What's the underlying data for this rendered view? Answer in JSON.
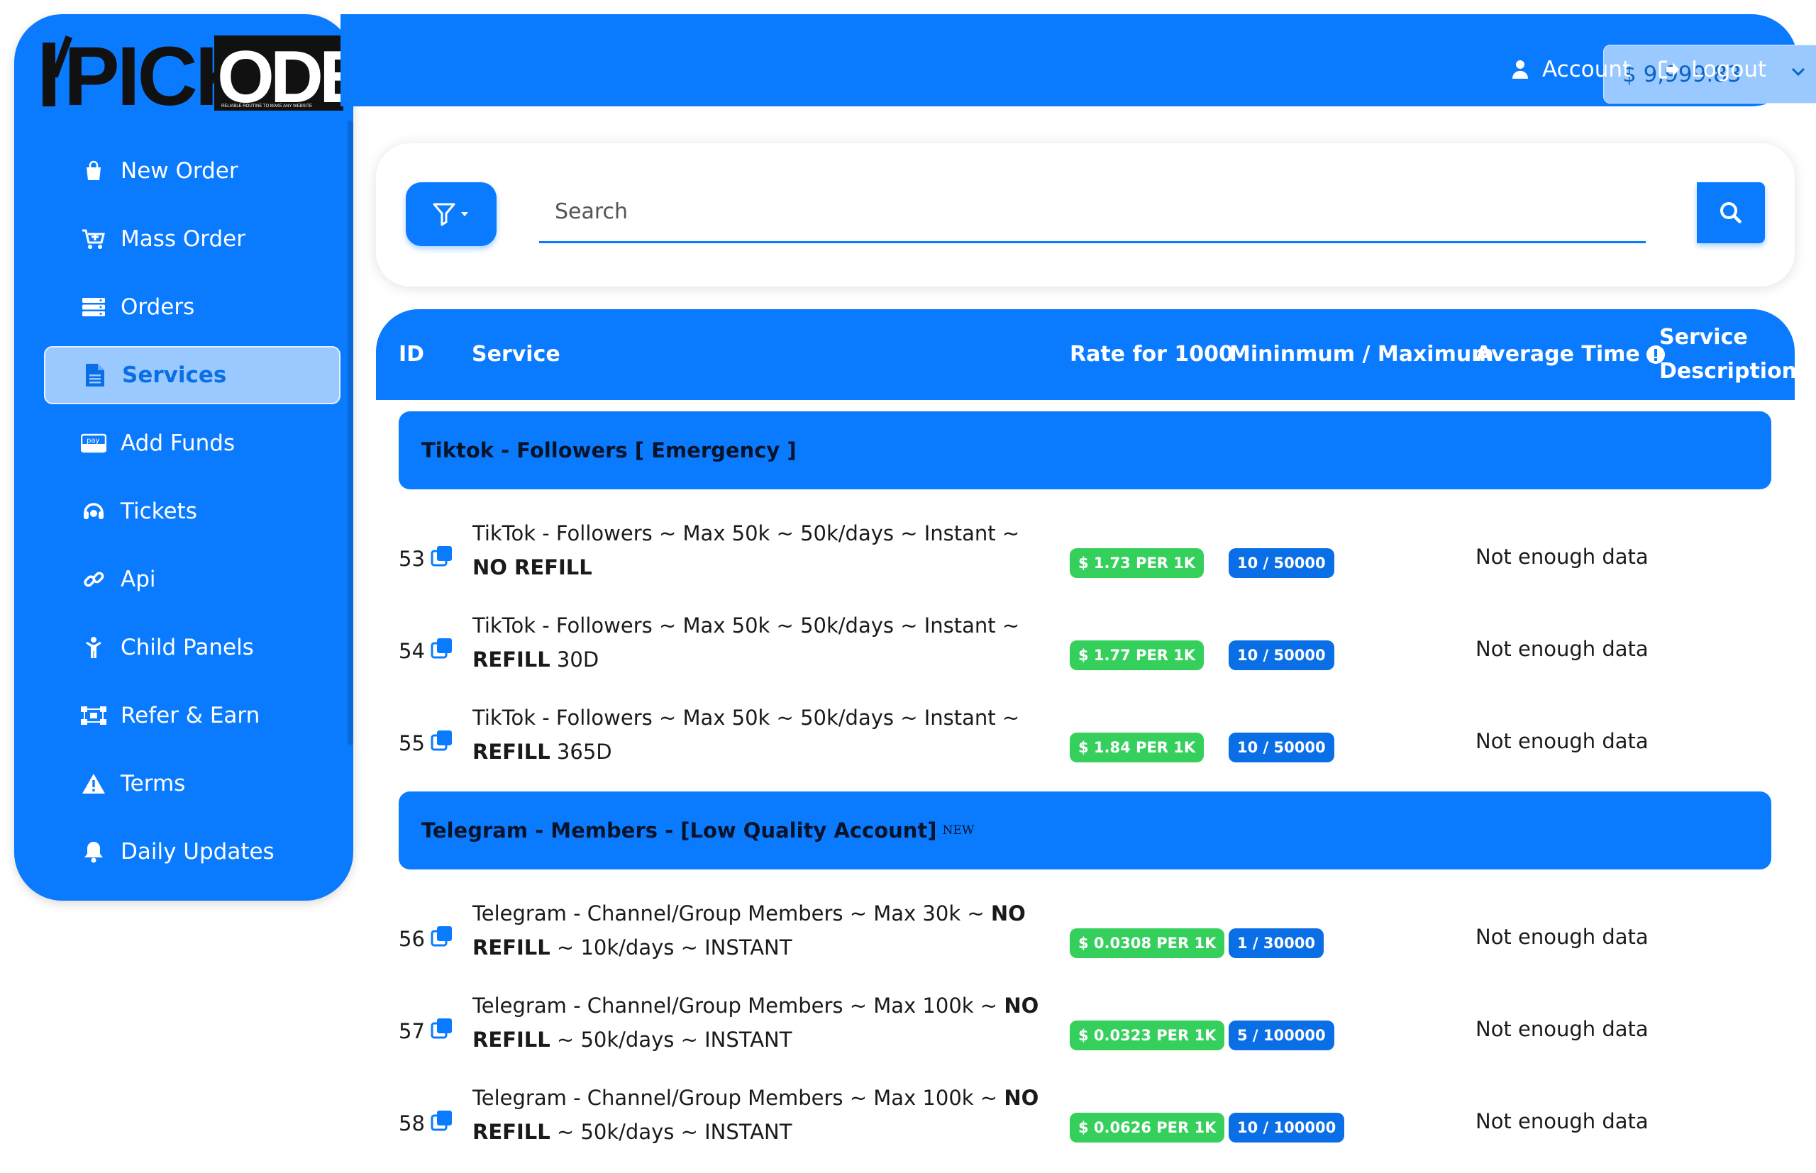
{
  "brand": {
    "logo_text": "PICKODER",
    "tagline": "RELIABLE ROUTINE TO MAKE ANY WEBSITE"
  },
  "header": {
    "balance": "$ 9,999.83",
    "account_label": "Account",
    "logout_label": "Logout"
  },
  "sidebar": {
    "items": [
      {
        "label": "New Order",
        "icon": "shopping-bag-icon"
      },
      {
        "label": "Mass Order",
        "icon": "cart-plus-icon"
      },
      {
        "label": "Orders",
        "icon": "list-icon"
      },
      {
        "label": "Services",
        "icon": "document-icon",
        "active": true
      },
      {
        "label": "Add Funds",
        "icon": "pay-icon"
      },
      {
        "label": "Tickets",
        "icon": "headset-icon"
      },
      {
        "label": "Api",
        "icon": "link-icon"
      },
      {
        "label": "Child Panels",
        "icon": "child-icon"
      },
      {
        "label": "Refer & Earn",
        "icon": "network-icon"
      },
      {
        "label": "Terms",
        "icon": "warning-icon"
      },
      {
        "label": "Daily Updates",
        "icon": "bell-icon"
      }
    ]
  },
  "search": {
    "placeholder": "Search"
  },
  "table": {
    "headers": {
      "id": "ID",
      "service": "Service",
      "rate": "Rate for 1000",
      "minmax": "Mininmum / Maximum",
      "avg": "Average Time",
      "desc_line1": "Service",
      "desc_line2": "Description"
    }
  },
  "categories": [
    {
      "title": "Tiktok - Followers [ Emergency ]",
      "badge": "",
      "services": [
        {
          "id": "53",
          "name": "TikTok - Followers ~ Max 50k ~ 50k/days ~ Instant ~ ",
          "name_bold": "NO REFILL",
          "name_rest": "",
          "rate": "$ 1.73 PER 1K",
          "minmax": "10 / 50000",
          "avg": "Not enough data"
        },
        {
          "id": "54",
          "name": "TikTok - Followers ~ Max 50k ~ 50k/days ~ Instant ~ ",
          "name_bold": "REFILL",
          "name_rest": " 30D",
          "rate": "$ 1.77 PER 1K",
          "minmax": "10 / 50000",
          "avg": "Not enough data"
        },
        {
          "id": "55",
          "name": "TikTok - Followers ~ Max 50k ~ 50k/days ~ Instant ~ ",
          "name_bold": "REFILL",
          "name_rest": " 365D",
          "rate": "$ 1.84 PER 1K",
          "minmax": "10 / 50000",
          "avg": "Not enough data"
        }
      ]
    },
    {
      "title": "Telegram - Members - [Low Quality Account]",
      "badge": "NEW",
      "services": [
        {
          "id": "56",
          "name": "Telegram - Channel/Group Members ~ Max 30k ~ ",
          "name_bold": "NO REFILL",
          "name_rest": " ~ 10k/days ~ INSTANT",
          "rate": "$ 0.0308 PER 1K",
          "minmax": "1 / 30000",
          "avg": "Not enough data"
        },
        {
          "id": "57",
          "name": "Telegram - Channel/Group Members ~ Max 100k ~ ",
          "name_bold": "NO REFILL",
          "name_rest": " ~ 50k/days ~ INSTANT",
          "rate": "$ 0.0323 PER 1K",
          "minmax": "5 / 100000",
          "avg": "Not enough data"
        },
        {
          "id": "58",
          "name": "Telegram - Channel/Group Members ~ Max 100k ~ ",
          "name_bold": "NO REFILL",
          "name_rest": " ~ 50k/days ~ INSTANT",
          "rate": "$ 0.0626 PER 1K",
          "minmax": "10 / 100000",
          "avg": "Not enough data"
        }
      ]
    }
  ],
  "colors": {
    "primary": "#0a7bff",
    "active_nav_bg": "#99c9ff",
    "rate_badge": "#35d05c",
    "minmax_badge": "#0a6fe6"
  }
}
